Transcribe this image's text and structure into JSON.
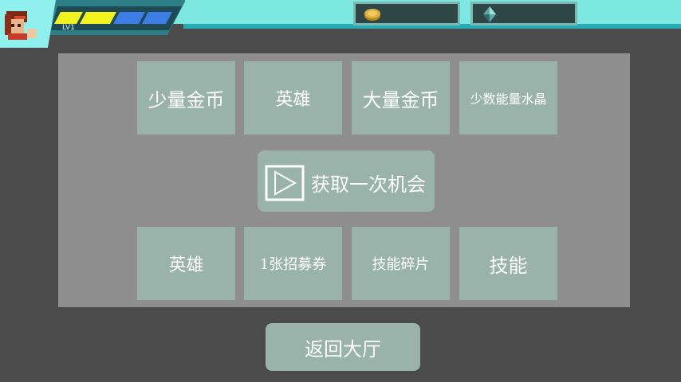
{
  "player": {
    "level": "LV1",
    "energy_segment_colors": [
      "#f2f21e",
      "#f2f21e",
      "#3d7de6",
      "#3d7de6"
    ]
  },
  "resources": {
    "gold": {
      "icon": "gold-coin-icon",
      "value": ""
    },
    "crystal": {
      "icon": "crystal-icon",
      "value": ""
    }
  },
  "rewards_top": [
    {
      "label": "少量金币"
    },
    {
      "label": "英雄"
    },
    {
      "label": "大量金币"
    },
    {
      "label": "少数能量水晶"
    }
  ],
  "ad_button": {
    "label": "获取一次机会",
    "icon": "play-icon"
  },
  "rewards_bottom": [
    {
      "label": "英雄"
    },
    {
      "label": "1张招募券"
    },
    {
      "label": "技能碎片"
    },
    {
      "label": "技能"
    }
  ],
  "back_button": {
    "label": "返回大厅"
  },
  "colors": {
    "background": "#4b4b4b",
    "panel": "#8e8e8e",
    "tile": "#99b3aa",
    "topbar": "#7de8e0"
  }
}
